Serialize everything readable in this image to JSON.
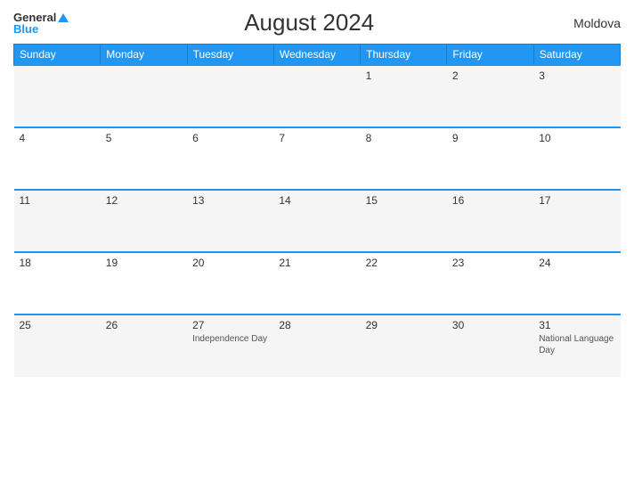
{
  "header": {
    "logo_general": "General",
    "logo_blue": "Blue",
    "title": "August 2024",
    "country": "Moldova"
  },
  "days_of_week": [
    "Sunday",
    "Monday",
    "Tuesday",
    "Wednesday",
    "Thursday",
    "Friday",
    "Saturday"
  ],
  "weeks": [
    [
      {
        "day": "",
        "event": ""
      },
      {
        "day": "",
        "event": ""
      },
      {
        "day": "",
        "event": ""
      },
      {
        "day": "",
        "event": ""
      },
      {
        "day": "1",
        "event": ""
      },
      {
        "day": "2",
        "event": ""
      },
      {
        "day": "3",
        "event": ""
      }
    ],
    [
      {
        "day": "4",
        "event": ""
      },
      {
        "day": "5",
        "event": ""
      },
      {
        "day": "6",
        "event": ""
      },
      {
        "day": "7",
        "event": ""
      },
      {
        "day": "8",
        "event": ""
      },
      {
        "day": "9",
        "event": ""
      },
      {
        "day": "10",
        "event": ""
      }
    ],
    [
      {
        "day": "11",
        "event": ""
      },
      {
        "day": "12",
        "event": ""
      },
      {
        "day": "13",
        "event": ""
      },
      {
        "day": "14",
        "event": ""
      },
      {
        "day": "15",
        "event": ""
      },
      {
        "day": "16",
        "event": ""
      },
      {
        "day": "17",
        "event": ""
      }
    ],
    [
      {
        "day": "18",
        "event": ""
      },
      {
        "day": "19",
        "event": ""
      },
      {
        "day": "20",
        "event": ""
      },
      {
        "day": "21",
        "event": ""
      },
      {
        "day": "22",
        "event": ""
      },
      {
        "day": "23",
        "event": ""
      },
      {
        "day": "24",
        "event": ""
      }
    ],
    [
      {
        "day": "25",
        "event": ""
      },
      {
        "day": "26",
        "event": ""
      },
      {
        "day": "27",
        "event": "Independence Day"
      },
      {
        "day": "28",
        "event": ""
      },
      {
        "day": "29",
        "event": ""
      },
      {
        "day": "30",
        "event": ""
      },
      {
        "day": "31",
        "event": "National Language Day"
      }
    ]
  ]
}
